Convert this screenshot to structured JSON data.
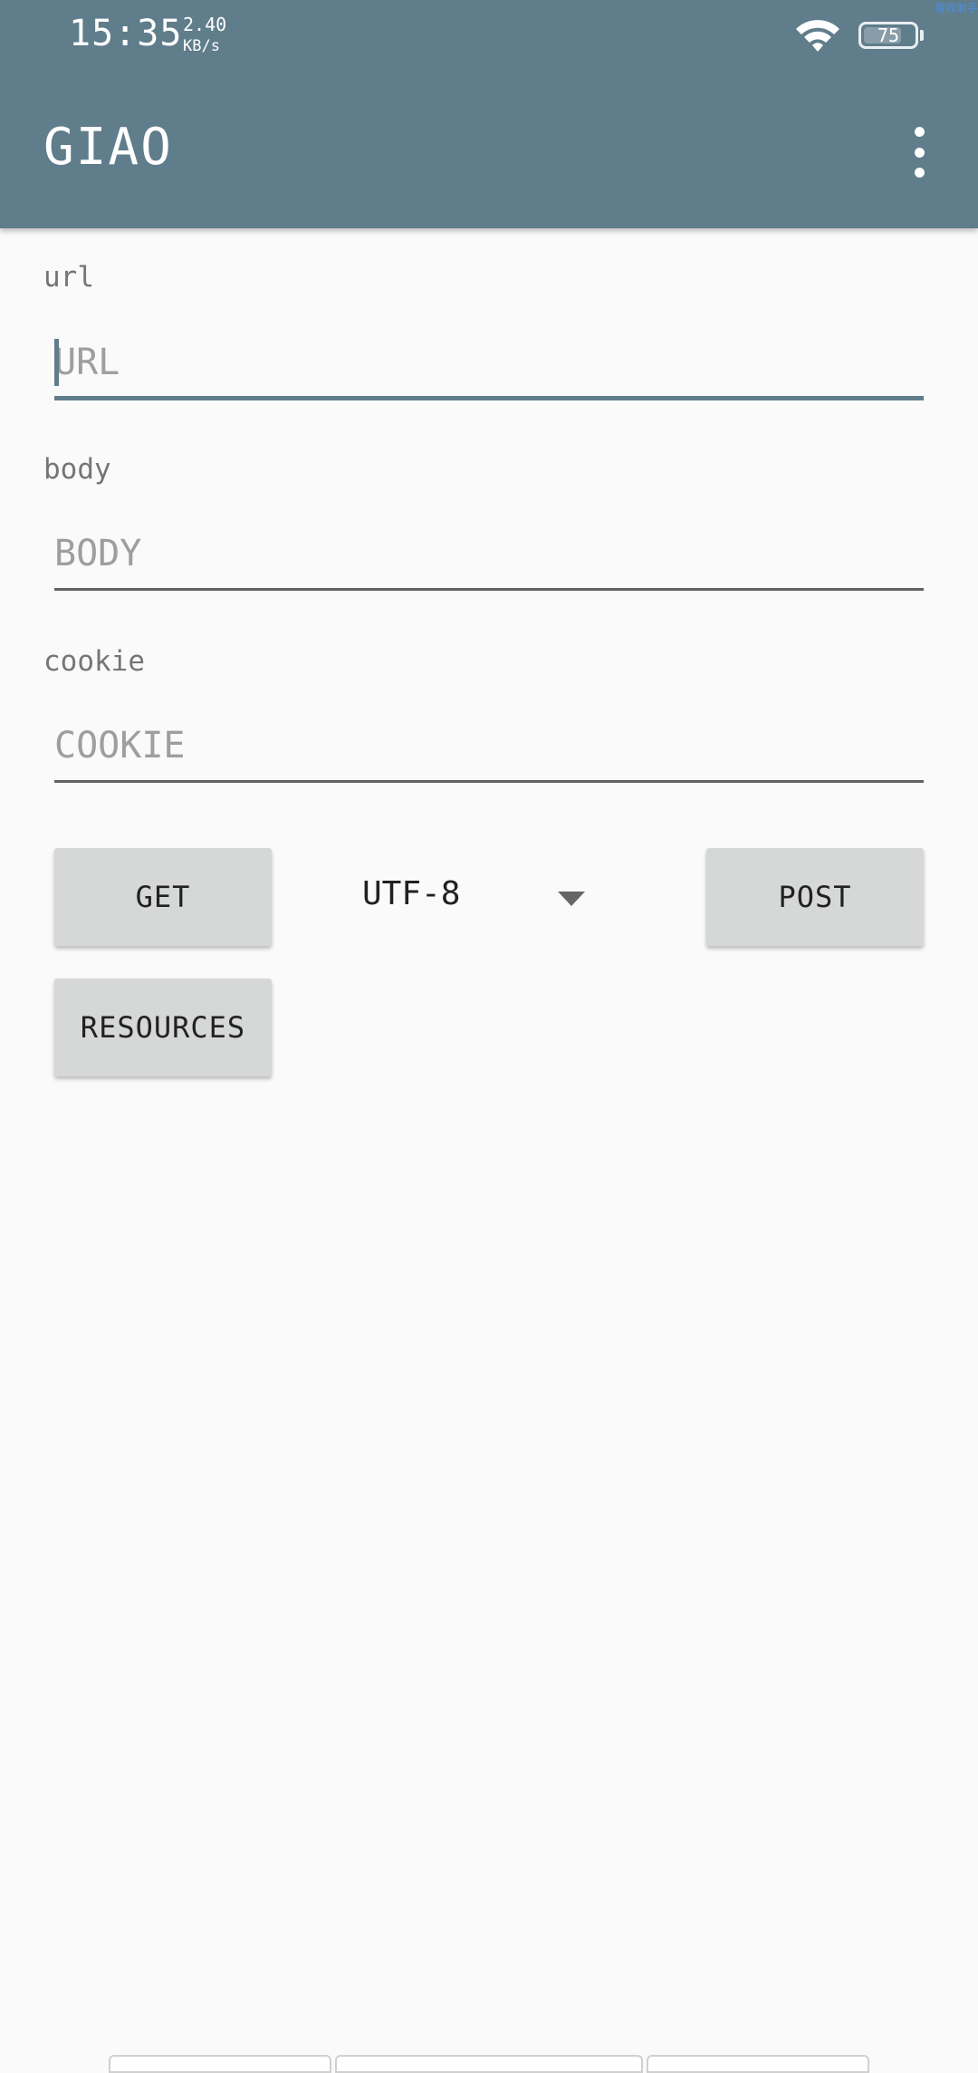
{
  "status_bar": {
    "time": "15:35",
    "net_speed_value": "2.40",
    "net_speed_unit": "KB/s",
    "battery_level": "75",
    "battery_fraction": 0.75,
    "wifi_icon": "wifi-icon",
    "corner_label": "游戏助手"
  },
  "app_bar": {
    "title": "GIAO",
    "menu_icon": "more-vert-icon",
    "background_color": "#607d8b"
  },
  "form": {
    "url": {
      "label": "url",
      "placeholder": "URL",
      "value": ""
    },
    "body": {
      "label": "body",
      "placeholder": "BODY",
      "value": ""
    },
    "cookie": {
      "label": "cookie",
      "placeholder": "COOKIE",
      "value": ""
    }
  },
  "actions": {
    "get_label": "GET",
    "post_label": "POST",
    "resources_label": "RESOURCES"
  },
  "charset_spinner": {
    "selected": "UTF-8",
    "icon": "dropdown-arrow-icon"
  }
}
